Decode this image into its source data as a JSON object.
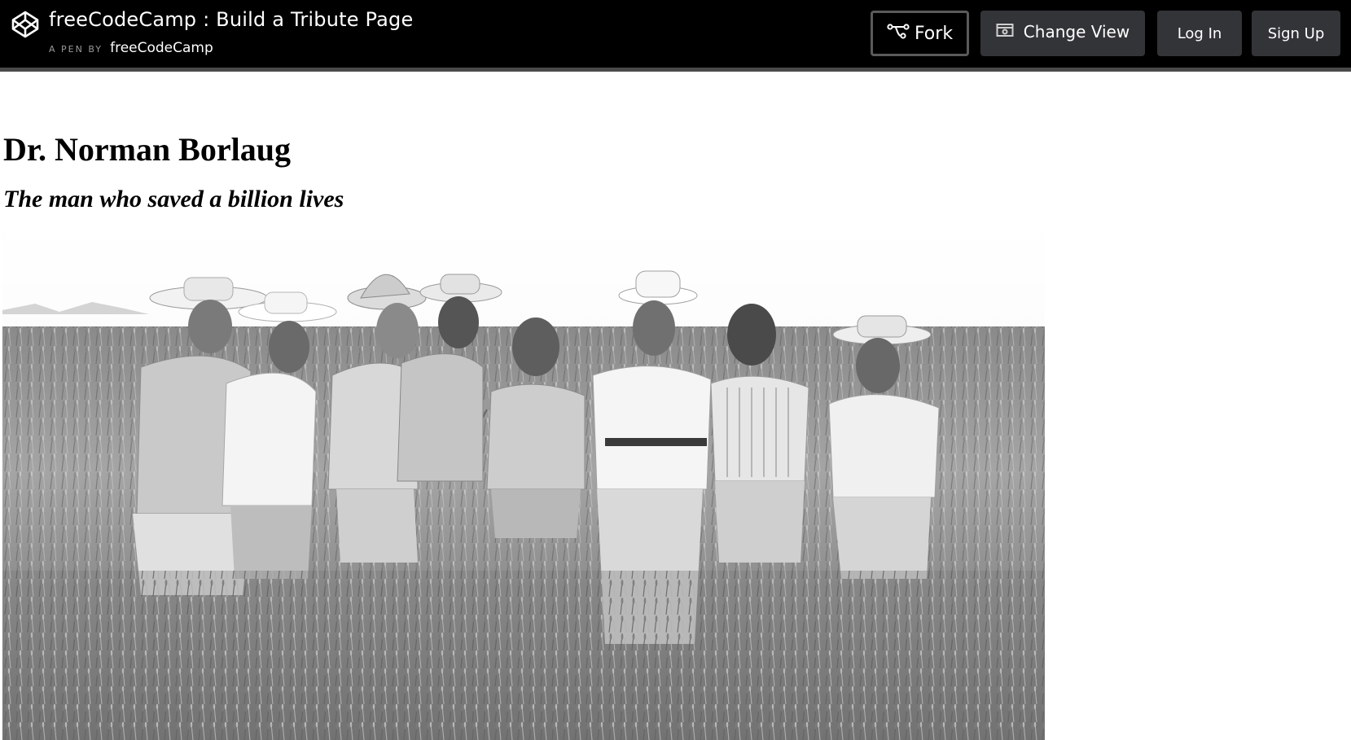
{
  "header": {
    "logo_icon": "codepen-logo-icon",
    "title": "freeCodeCamp : Build a Tribute Page",
    "byline_prefix": "A PEN BY",
    "author": "freeCodeCamp"
  },
  "toolbar": {
    "fork_label": "Fork",
    "fork_icon": "fork-icon",
    "change_view_label": "Change View",
    "change_view_icon": "change-view-icon",
    "login_label": "Log In",
    "signup_label": "Sign Up"
  },
  "colors": {
    "topbar_background": "#000000",
    "button_background": "#333438",
    "page_background": "#ffffff"
  },
  "tribute": {
    "title": "Dr. Norman Borlaug",
    "subtitle": "The man who saved a billion lives",
    "image_subject": "black-and-white photo of men in hats standing in a wheat field"
  }
}
